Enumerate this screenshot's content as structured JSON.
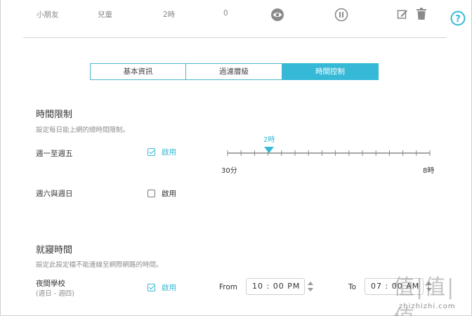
{
  "profile_row": {
    "name": "小朋友",
    "type": "兒童",
    "time": "2時",
    "count": "0",
    "icons": [
      "eye-icon",
      "pause-icon",
      "edit-icon",
      "trash-icon"
    ]
  },
  "help_icon": "question-icon",
  "tabs": [
    {
      "label": "基本資訊",
      "active": false
    },
    {
      "label": "過濾層級",
      "active": false
    },
    {
      "label": "時間控制",
      "active": true
    }
  ],
  "time_limit": {
    "title": "時間限制",
    "description": "設定每日能上網的總時間限制。",
    "weekdays": {
      "label": "週一至週五",
      "enabled": true,
      "enable_label": "啟用",
      "slider": {
        "value_label": "2時",
        "min_label": "30分",
        "max_label": "8時",
        "value_fraction": 0.2
      }
    },
    "weekend": {
      "label": "週六與週日",
      "enabled": false,
      "enable_label": "啟用"
    }
  },
  "bedtime": {
    "title": "就寢時間",
    "description": "設定此設定檔不能連線至網際網路的時間。",
    "school_night": {
      "label": "夜間學校",
      "sub_label": "(週日 - 週四)",
      "enabled": true,
      "enable_label": "啟用",
      "from_label": "From",
      "from_value": "10 : 00  PM",
      "to_label": "To",
      "to_value": "07 : 00  AM"
    }
  },
  "watermark": {
    "text": "值|值|值",
    "sub": "zhizhizhi.com"
  },
  "colors": {
    "accent": "#35b9d6",
    "tab_border": "#4fb5cc"
  }
}
